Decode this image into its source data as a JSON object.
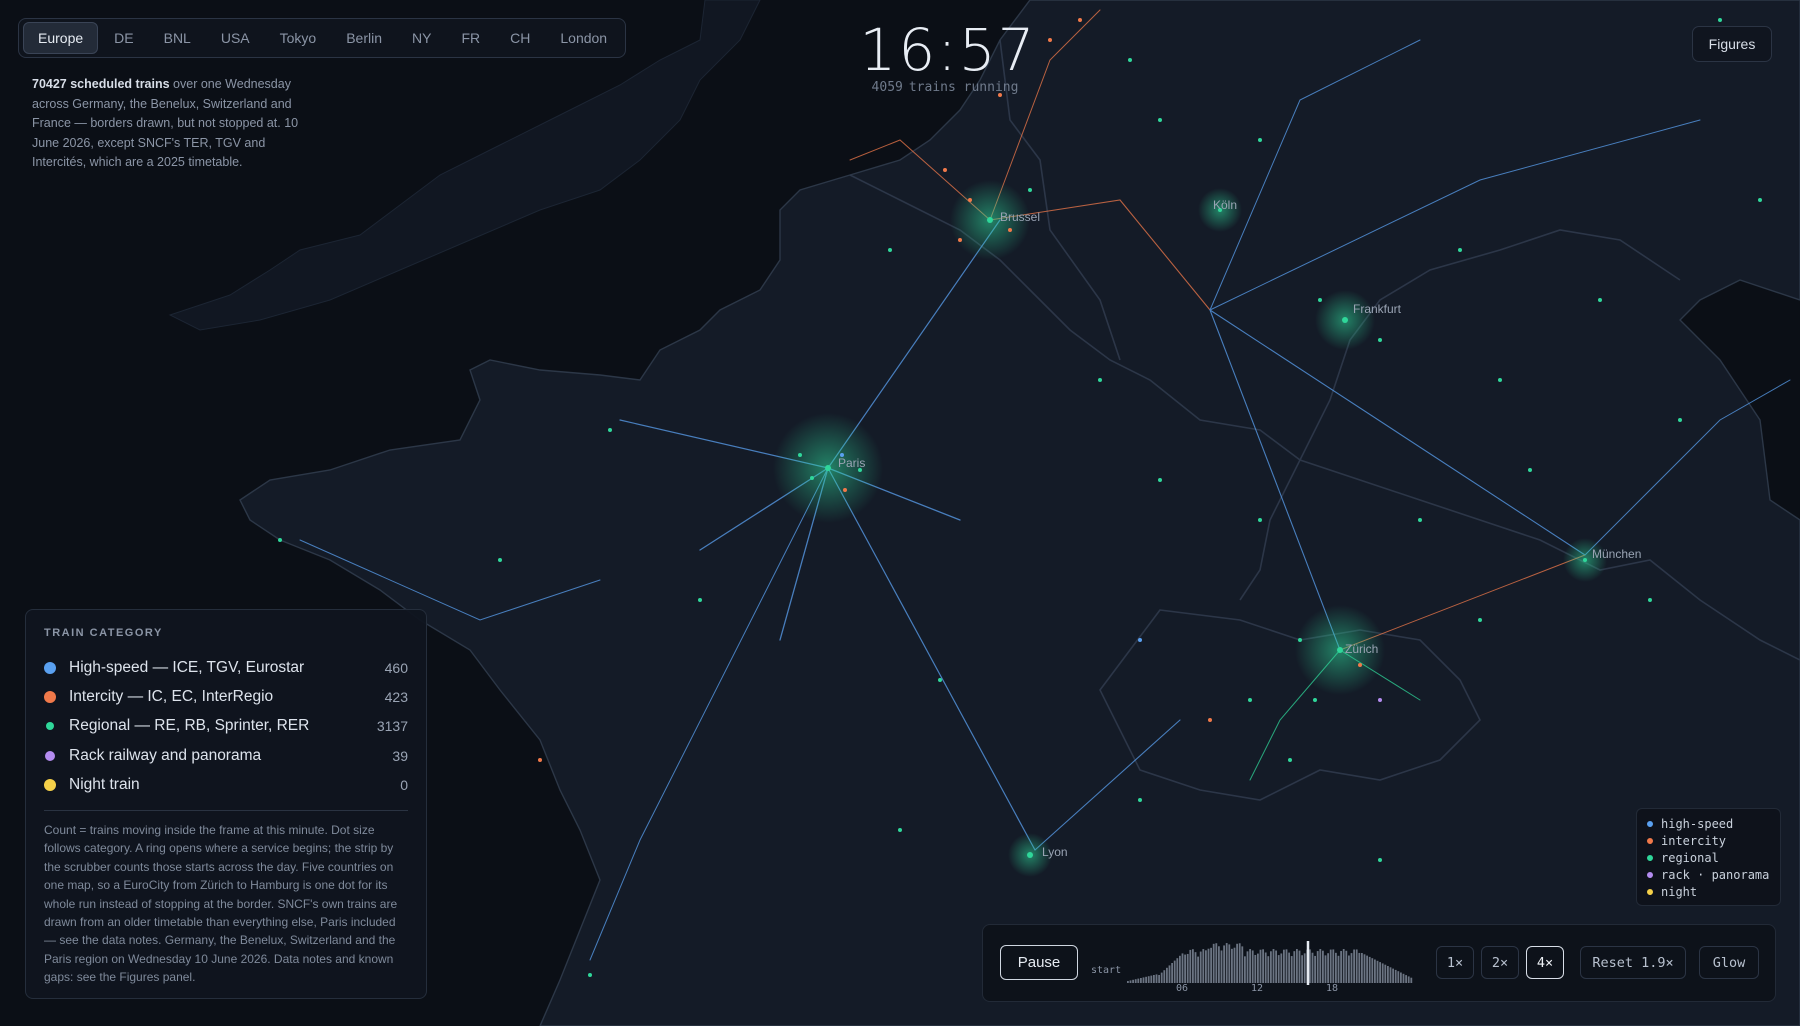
{
  "tabs": [
    {
      "label": "Europe",
      "active": true
    },
    {
      "label": "DE",
      "active": false
    },
    {
      "label": "BNL",
      "active": false
    },
    {
      "label": "USA",
      "active": false
    },
    {
      "label": "Tokyo",
      "active": false
    },
    {
      "label": "Berlin",
      "active": false
    },
    {
      "label": "NY",
      "active": false
    },
    {
      "label": "FR",
      "active": false
    },
    {
      "label": "CH",
      "active": false
    },
    {
      "label": "London",
      "active": false
    }
  ],
  "intro": {
    "count": "70427 scheduled trains",
    "text": " over one Wednesday across Germany, the Benelux, Switzerland and France — borders drawn, but not stopped at. 10 June 2026, except SNCF's TER, TGV and Intercités, which are a 2025 timetable."
  },
  "clock": {
    "time": "16:57",
    "running_count": "4059",
    "running_label": "trains running"
  },
  "figures_label": "Figures",
  "cities": [
    "Brussel",
    "Köln",
    "Frankfurt",
    "Paris",
    "München",
    "Zürich",
    "Lyon"
  ],
  "legend": {
    "title": "TRAIN CATEGORY",
    "categories": [
      {
        "label": "High-speed — ICE, TGV, Eurostar",
        "count": "460",
        "color": "#5aa0f0"
      },
      {
        "label": "Intercity — IC, EC, InterRegio",
        "count": "423",
        "color": "#f0794a"
      },
      {
        "label": "Regional — RE, RB, Sprinter, RER",
        "count": "3137",
        "color": "#2fd79a"
      },
      {
        "label": "Rack railway and panorama",
        "count": "39",
        "color": "#b48cf0"
      },
      {
        "label": "Night train",
        "count": "0",
        "color": "#f5d049"
      }
    ],
    "notes": "Count = trains moving inside the frame at this minute. Dot size follows category. A ring opens where a service begins; the strip by the scrubber counts those starts across the day. Five countries on one map, so a EuroCity from Zürich to Hamburg is one dot for its whole run instead of stopping at the border. SNCF's own trains are drawn from an older timetable than everything else, Paris included — see the data notes. Germany, the Benelux, Switzerland and the Paris region on Wednesday 10 June 2026. Data notes and known gaps: see the Figures panel."
  },
  "mini_legend": [
    {
      "label": "high-speed",
      "color": "#5aa0f0"
    },
    {
      "label": "intercity",
      "color": "#f0794a"
    },
    {
      "label": "regional",
      "color": "#2fd79a"
    },
    {
      "label": "rack · panorama",
      "color": "#b48cf0"
    },
    {
      "label": "night",
      "color": "#f5d049"
    }
  ],
  "controls": {
    "pause_label": "Pause",
    "start_label": "start",
    "hour_ticks": [
      "06",
      "12",
      "18"
    ],
    "speed_buttons": [
      {
        "label": "1×",
        "active": false
      },
      {
        "label": "2×",
        "active": false
      },
      {
        "label": "4×",
        "active": true
      }
    ],
    "reset_label": "Reset 1.9×",
    "glow_label": "Glow"
  }
}
